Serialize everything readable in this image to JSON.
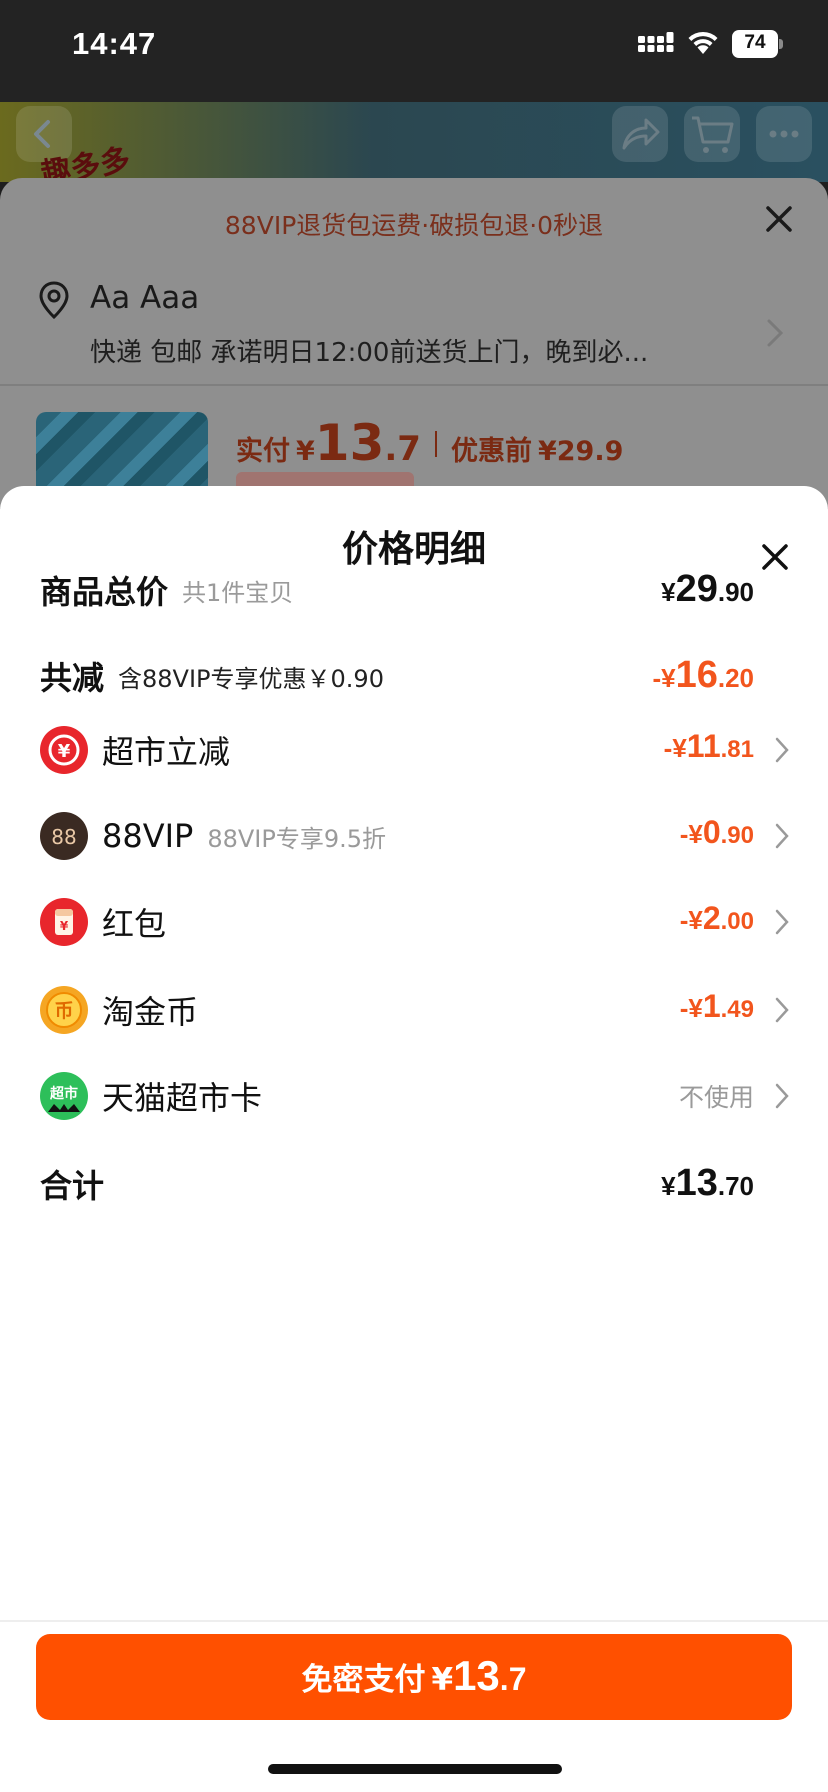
{
  "status_bar": {
    "time": "14:47",
    "battery": "74"
  },
  "product_header": {
    "logo_text": "趣多多"
  },
  "order_sheet": {
    "promo_text": "88VIP退货包运费·破损包退·0秒退",
    "address_name": "Aa Aaa",
    "address_detail": "快递 包邮 承诺明日12:00前送货上门，晚到必...",
    "price_label": "实付",
    "price_yen": "¥",
    "price_int": "13",
    "price_dec": ".7",
    "before_label": "优惠前",
    "before_price": "¥29.9"
  },
  "modal": {
    "title": "价格明细",
    "subtotal": {
      "label": "商品总价",
      "sub": "共1件宝贝",
      "yen": "¥",
      "int": "29",
      "dec": ".90"
    },
    "reduction": {
      "label": "共减",
      "sub": "含88VIP专享优惠￥0.90",
      "yen": "-¥",
      "int": "16",
      "dec": ".20"
    },
    "items": [
      {
        "label": "超市立减",
        "sub": "",
        "icon": "supermarket-discount-icon",
        "yen": "-¥",
        "int": "11",
        "dec": ".81"
      },
      {
        "label": "88VIP",
        "sub": "88VIP专享9.5折",
        "icon": "88vip-icon",
        "yen": "-¥",
        "int": "0",
        "dec": ".90"
      },
      {
        "label": "红包",
        "sub": "",
        "icon": "red-packet-icon",
        "yen": "-¥",
        "int": "2",
        "dec": ".00"
      },
      {
        "label": "淘金币",
        "sub": "",
        "icon": "taojinbi-coin-icon",
        "yen": "-¥",
        "int": "1",
        "dec": ".49"
      },
      {
        "label": "天猫超市卡",
        "sub": "",
        "icon": "tmall-supermarket-card-icon",
        "status": "不使用"
      }
    ],
    "total": {
      "label": "合计",
      "yen": "¥",
      "int": "13",
      "dec": ".70"
    },
    "icon_badges": {
      "discount": "¥",
      "vip": "88",
      "coin": "币",
      "card": "超市"
    }
  },
  "pay_button": {
    "label": "免密支付",
    "yen": "¥",
    "int": "13",
    "dec": ".7"
  },
  "colors": {
    "accent": "#ff5000",
    "discount_text": "#f2551d",
    "muted": "#9a9a9a"
  }
}
